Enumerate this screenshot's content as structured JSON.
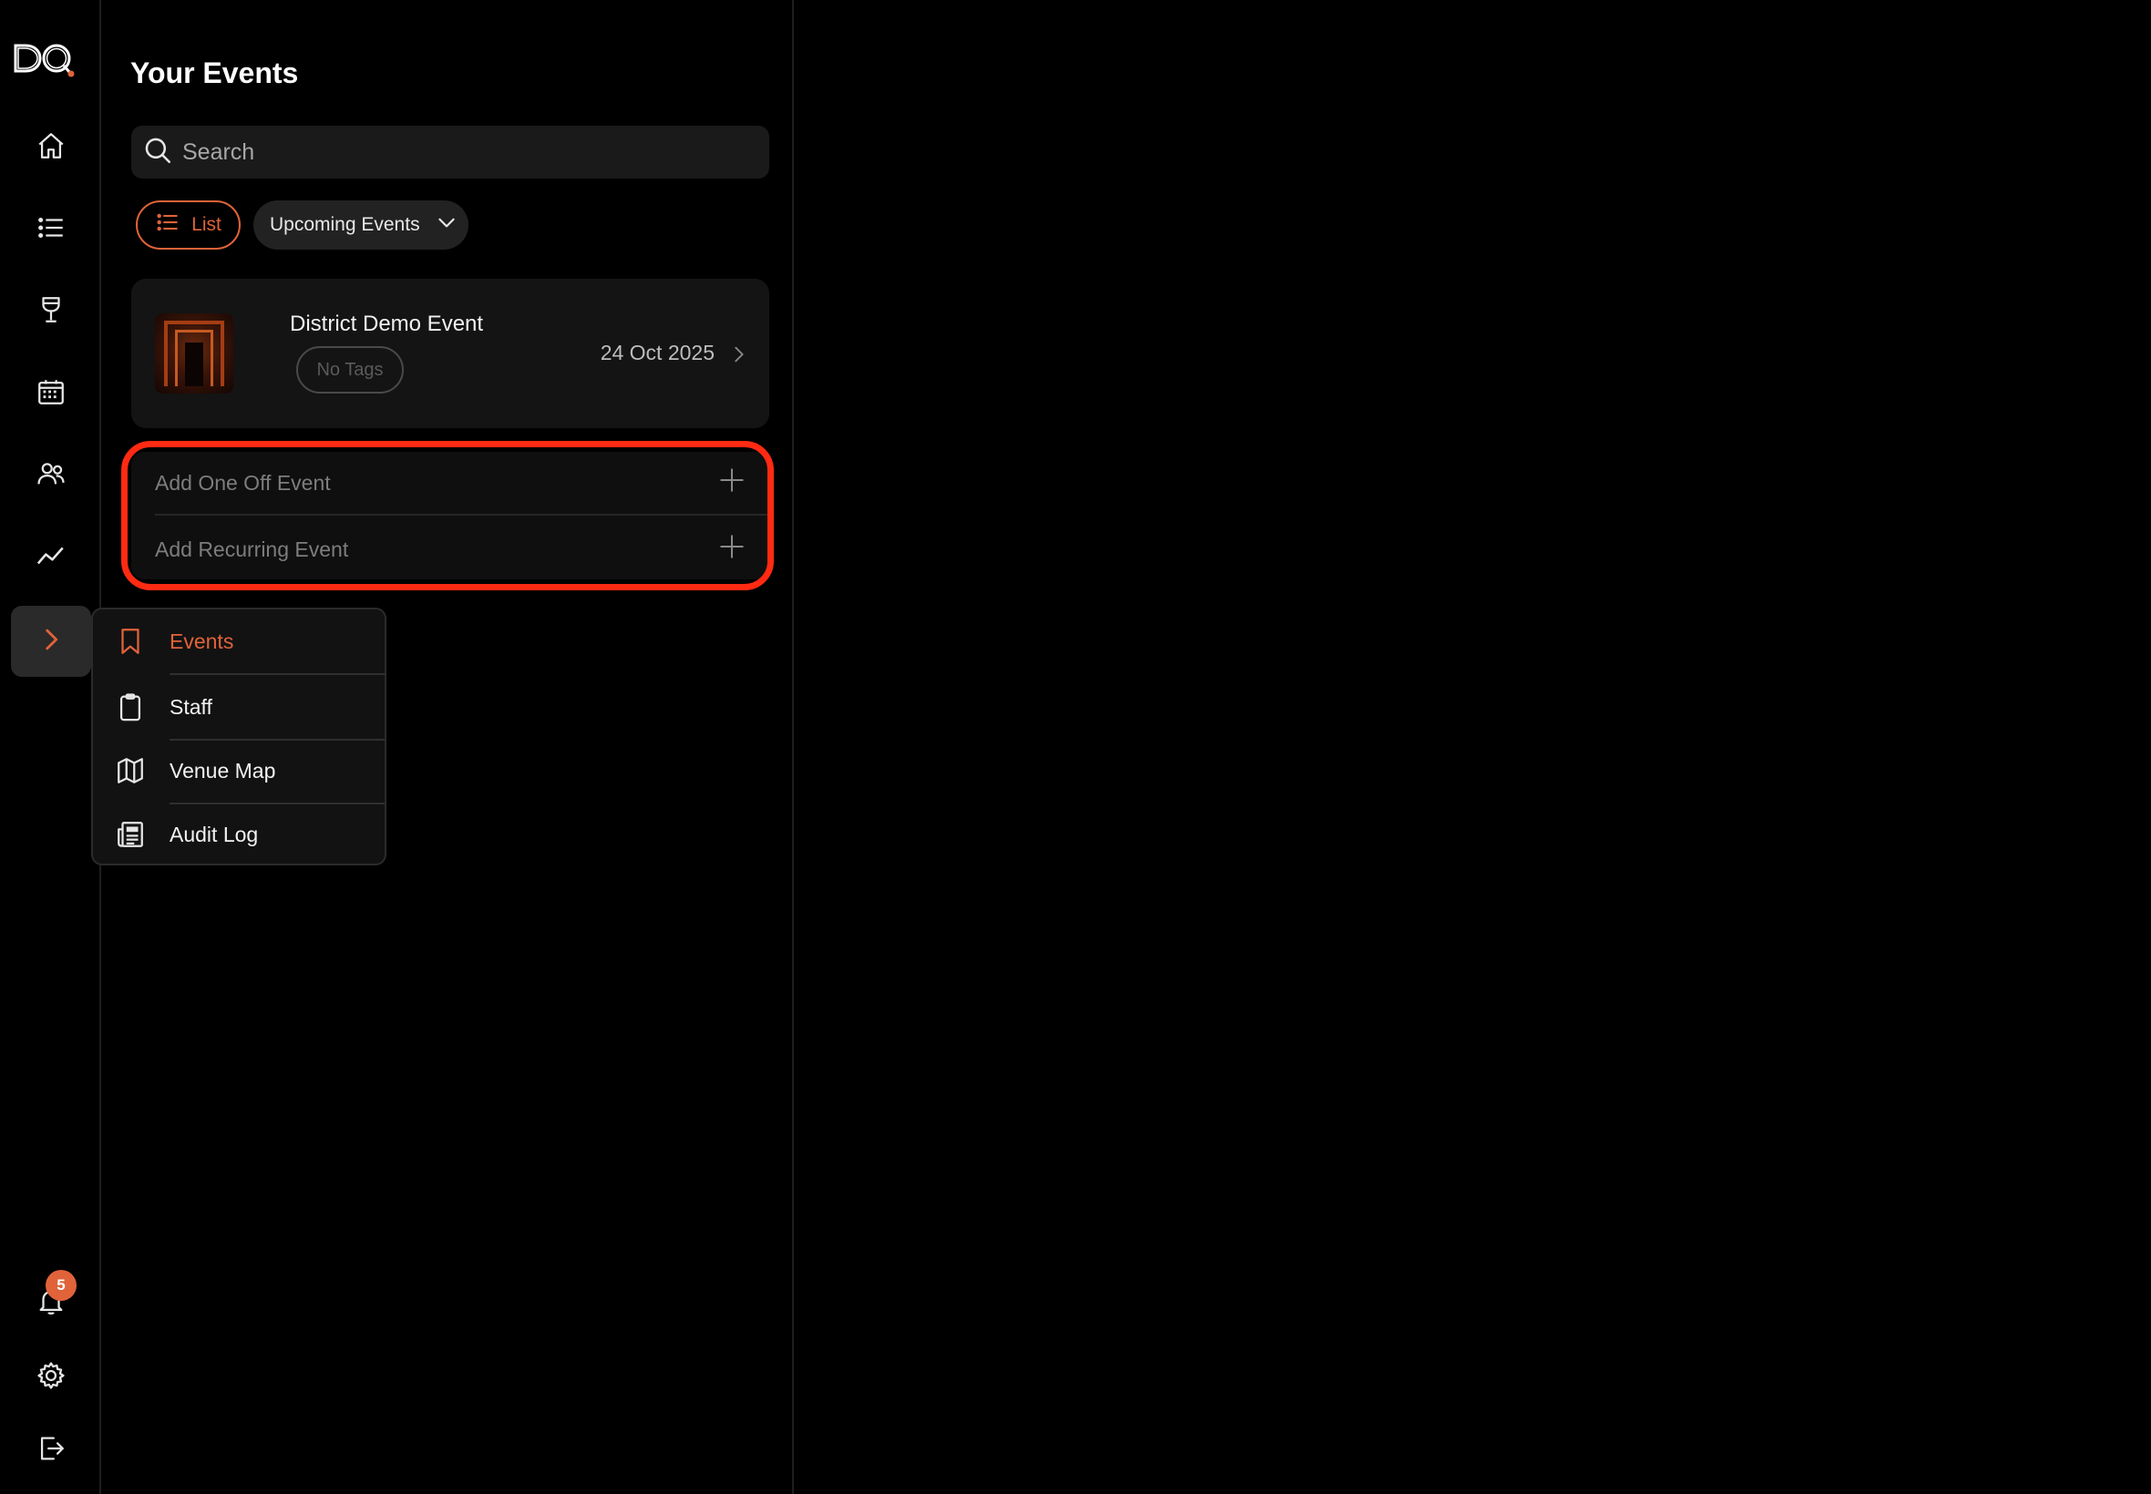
{
  "app": {
    "logo_text": "DQ",
    "accent_color": "#e0633a"
  },
  "rail": {
    "items": [
      {
        "name": "home-icon"
      },
      {
        "name": "list-icon"
      },
      {
        "name": "cocktail-glass-icon"
      },
      {
        "name": "calendar-icon"
      },
      {
        "name": "users-icon"
      },
      {
        "name": "analytics-trend-icon"
      },
      {
        "name": "chevron-right-icon",
        "active": true
      }
    ],
    "notifications": {
      "count": "5"
    },
    "bottom_items": [
      "bell-icon",
      "gear-icon",
      "logout-icon"
    ]
  },
  "events_panel": {
    "title": "Your Events",
    "search": {
      "placeholder": "Search",
      "value": ""
    },
    "view_toggle": {
      "label": "List"
    },
    "filter": {
      "selected": "Upcoming Events"
    },
    "events": [
      {
        "name": "District Demo Event",
        "tag": "No Tags",
        "date": "24 Oct 2025"
      }
    ],
    "add_actions": {
      "one_off": "Add One Off Event",
      "recurring": "Add Recurring Event"
    }
  },
  "popup_menu": {
    "items": [
      {
        "label": "Events",
        "icon": "bookmark-icon",
        "active": true
      },
      {
        "label": "Staff",
        "icon": "clipboard-icon"
      },
      {
        "label": "Venue Map",
        "icon": "map-icon"
      },
      {
        "label": "Audit Log",
        "icon": "newspaper-icon"
      }
    ]
  }
}
